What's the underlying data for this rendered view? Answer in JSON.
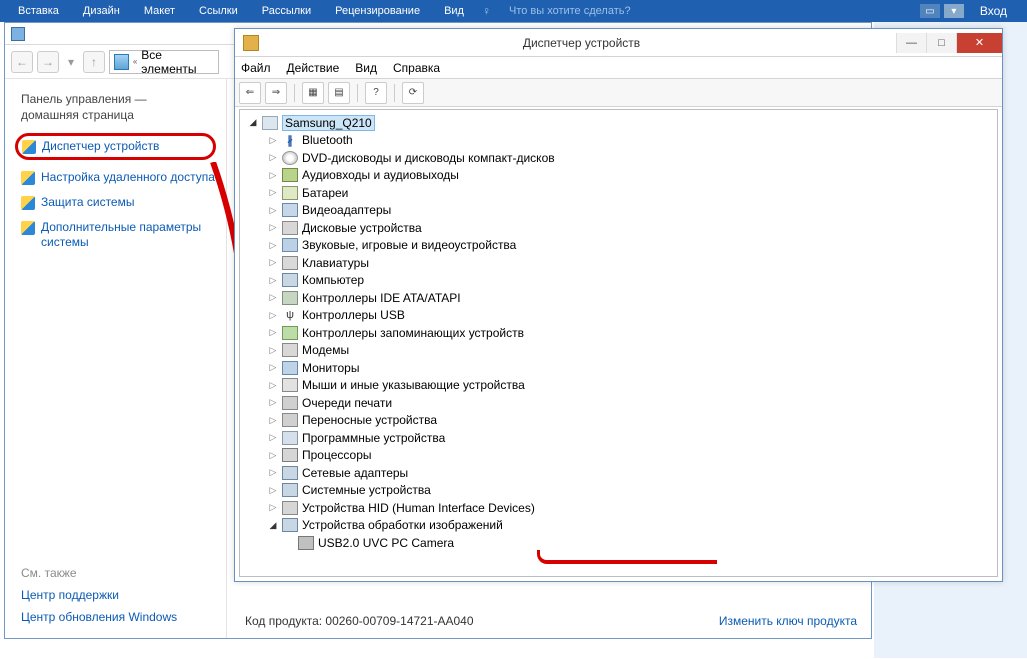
{
  "ribbon": {
    "tabs": [
      "Вставка",
      "Дизайн",
      "Макет",
      "Ссылки",
      "Рассылки",
      "Рецензирование",
      "Вид"
    ],
    "tell_me": "Что вы хотите сделать?",
    "right": "Вход"
  },
  "control_panel": {
    "breadcrumb": "Все элементы",
    "heading1": "Панель управления —",
    "heading2": "домашняя страница",
    "links": {
      "device_manager": "Диспетчер устройств",
      "remote_settings": "Настройка удаленного доступа",
      "system_protection": "Защита системы",
      "advanced": "Дополнительные параметры системы"
    },
    "see_also": "См. также",
    "support_center": "Центр поддержки",
    "windows_update": "Центр обновления Windows",
    "product_key_label": "Код продукта:  00260-00709-14721-AA040",
    "change_key": "Изменить ключ продукта"
  },
  "device_manager": {
    "title": "Диспетчер устройств",
    "menu": [
      "Файл",
      "Действие",
      "Вид",
      "Справка"
    ],
    "root": "Samsung_Q210",
    "categories": [
      {
        "label": "Bluetooth",
        "ic": "ic-bt",
        "glyph": "∦"
      },
      {
        "label": "DVD-дисководы и дисководы компакт-дисков",
        "ic": "ic-dvd"
      },
      {
        "label": "Аудиовходы и аудиовыходы",
        "ic": "ic-audio"
      },
      {
        "label": "Батареи",
        "ic": "ic-bat"
      },
      {
        "label": "Видеоадаптеры",
        "ic": "ic-video"
      },
      {
        "label": "Дисковые устройства",
        "ic": "ic-disk"
      },
      {
        "label": "Звуковые, игровые и видеоустройства",
        "ic": "ic-snd"
      },
      {
        "label": "Клавиатуры",
        "ic": "ic-kbd"
      },
      {
        "label": "Компьютер",
        "ic": "ic-comp"
      },
      {
        "label": "Контроллеры IDE ATA/ATAPI",
        "ic": "ic-ide"
      },
      {
        "label": "Контроллеры USB",
        "ic": "ic-usb",
        "glyph": "ψ"
      },
      {
        "label": "Контроллеры запоминающих устройств",
        "ic": "ic-stor"
      },
      {
        "label": "Модемы",
        "ic": "ic-modem"
      },
      {
        "label": "Мониторы",
        "ic": "ic-mon"
      },
      {
        "label": "Мыши и иные указывающие устройства",
        "ic": "ic-mouse"
      },
      {
        "label": "Очереди печати",
        "ic": "ic-print"
      },
      {
        "label": "Переносные устройства",
        "ic": "ic-port"
      },
      {
        "label": "Программные устройства",
        "ic": "ic-soft"
      },
      {
        "label": "Процессоры",
        "ic": "ic-cpu"
      },
      {
        "label": "Сетевые адаптеры",
        "ic": "ic-net"
      },
      {
        "label": "Системные устройства",
        "ic": "ic-sys"
      },
      {
        "label": "Устройства HID (Human Interface Devices)",
        "ic": "ic-hid"
      },
      {
        "label": "Устройства обработки изображений",
        "ic": "ic-img",
        "open": true
      }
    ],
    "camera": "USB2.0 UVC PC Camera"
  }
}
